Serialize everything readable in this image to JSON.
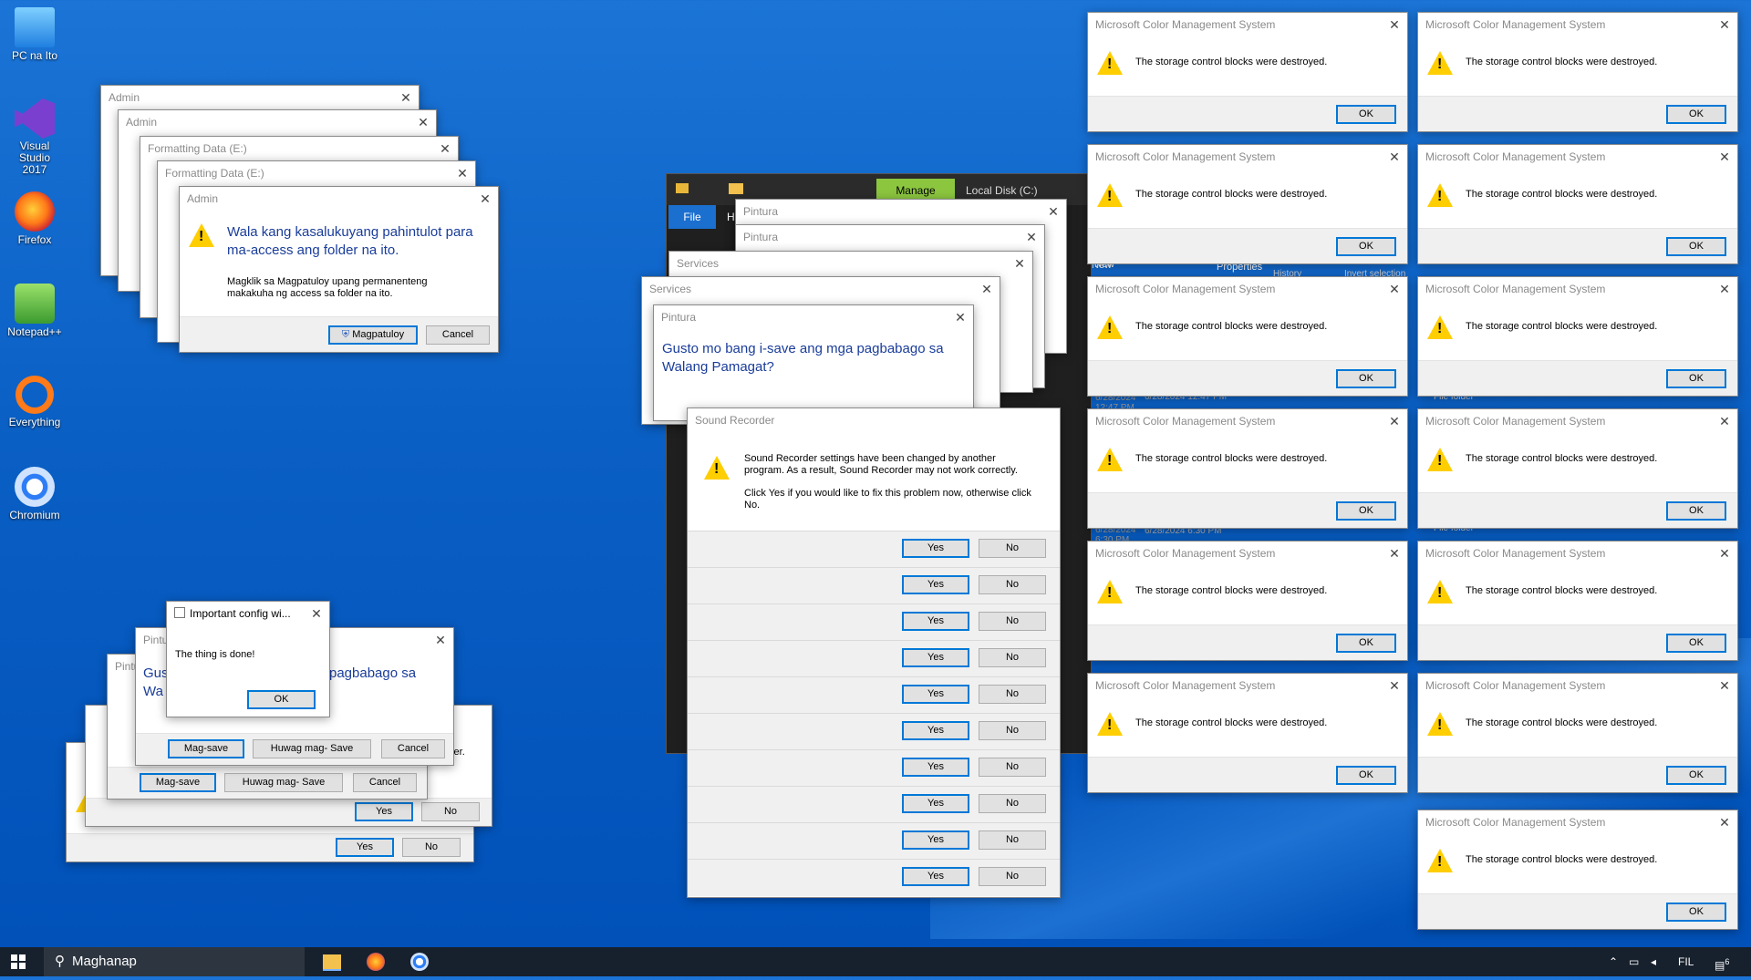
{
  "desktop": {
    "icons": [
      {
        "label": "PC na Ito"
      },
      {
        "label": "Visual Studio 2017"
      },
      {
        "label": "Firefox"
      },
      {
        "label": "Notepad++"
      },
      {
        "label": "Everything"
      },
      {
        "label": "Chromium"
      }
    ]
  },
  "admin_stack": {
    "title_admin": "Admin",
    "title_format": "Formatting Data (E:)",
    "heading": "Wala kang kasalukuyang pahintulot para ma-access ang folder na ito.",
    "body": "Magklik sa Magpatuloy upang permanenteng makakuha ng access sa folder na ito.",
    "continue_label": "Magpatuloy",
    "cancel_label": "Cancel"
  },
  "paint_save_bottom": {
    "title": "Pintura",
    "heading": "Gusto mo bang i-save ang mga pagbabago sa Walang Pamagat?",
    "save_label": "Mag-save",
    "dont_save_label": "Huwag mag- Save",
    "cancel_label": "Cancel",
    "yes_label": "Yes",
    "no_label": "No",
    "partial_text": "lder.",
    "partial_heading_left": "Gus",
    "partial_heading_right": "pagbabago sa",
    "partial_heading_line2": "Wa"
  },
  "important_config": {
    "title": "Important config wi...",
    "message": "The thing is done!",
    "ok_label": "OK"
  },
  "explorer": {
    "manage_label": "Manage",
    "disk_label": "Local Disk (C:)",
    "file_tab": "File",
    "home_tab": "Home",
    "new_label": "New",
    "properties_label": "Properties",
    "history_label": "History",
    "invert_label": "Invert selection",
    "date_text": "6/28/2024 12:47 PM",
    "date_text2": "6/28/2024 6:30 PM",
    "folder_text": "File folder"
  },
  "paint_save_center": {
    "title": "Pintura",
    "heading": "Gusto mo bang i-save ang mga pagbabago sa Walang Pamagat?"
  },
  "services": {
    "title": "Services"
  },
  "sound_recorder": {
    "title": "Sound Recorder",
    "line1": "Sound Recorder settings have been changed by another program.  As a result, Sound Recorder may not work correctly.",
    "line2": "Click Yes if you would like to fix this problem now, otherwise click No.",
    "yes_label": "Yes",
    "no_label": "No"
  },
  "mcms": {
    "title": "Microsoft Color Management System",
    "message": "The storage control blocks were destroyed.",
    "ok_label": "OK"
  },
  "taskbar": {
    "search_text": "Maghanap",
    "lang": "FIL",
    "notif_count": "6"
  },
  "colors": {
    "accent": "#0078d7",
    "warning": "#ffce00",
    "desktop": "#0a5fc4",
    "manage": "#8cc63f"
  }
}
